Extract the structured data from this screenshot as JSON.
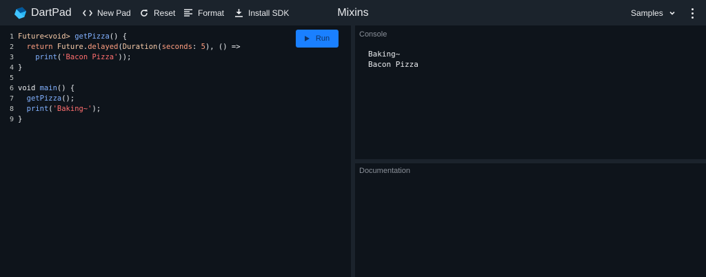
{
  "app": {
    "name": "DartPad",
    "title": "Mixins"
  },
  "toolbar": {
    "new_pad": "New Pad",
    "reset": "Reset",
    "format": "Format",
    "install_sdk": "Install SDK",
    "samples": "Samples"
  },
  "editor": {
    "run_label": "Run",
    "lines": [
      {
        "n": "1",
        "tokens": [
          [
            "Future<void> ",
            "t-type"
          ],
          [
            "getPizza",
            "t-fn"
          ],
          [
            "() {",
            ""
          ]
        ]
      },
      {
        "n": "2",
        "tokens": [
          [
            "  ",
            ""
          ],
          [
            "return ",
            "t-ret"
          ],
          [
            "Future",
            "t-type"
          ],
          [
            ".",
            ""
          ],
          [
            "delayed",
            "t-param"
          ],
          [
            "(",
            ""
          ],
          [
            "Duration",
            "t-type"
          ],
          [
            "(",
            ""
          ],
          [
            "seconds",
            "t-param"
          ],
          [
            ": ",
            ""
          ],
          [
            "5",
            "t-num"
          ],
          [
            "), () =>",
            ""
          ]
        ]
      },
      {
        "n": "3",
        "tokens": [
          [
            "    ",
            ""
          ],
          [
            "print",
            "t-fn"
          ],
          [
            "(",
            ""
          ],
          [
            "'Bacon Pizza'",
            "t-str"
          ],
          [
            "));",
            ""
          ]
        ]
      },
      {
        "n": "4",
        "tokens": [
          [
            "}",
            ""
          ]
        ]
      },
      {
        "n": "5",
        "tokens": [
          [
            "",
            ""
          ]
        ]
      },
      {
        "n": "6",
        "tokens": [
          [
            "void ",
            "t-kw"
          ],
          [
            "main",
            "t-fn"
          ],
          [
            "() {",
            ""
          ]
        ]
      },
      {
        "n": "7",
        "tokens": [
          [
            "  ",
            ""
          ],
          [
            "getPizza",
            "t-fn"
          ],
          [
            "();",
            ""
          ]
        ]
      },
      {
        "n": "8",
        "tokens": [
          [
            "  ",
            ""
          ],
          [
            "print",
            "t-fn"
          ],
          [
            "(",
            ""
          ],
          [
            "'Baking~'",
            "t-str"
          ],
          [
            ");",
            ""
          ]
        ]
      },
      {
        "n": "9",
        "tokens": [
          [
            "}",
            ""
          ]
        ]
      }
    ]
  },
  "console": {
    "title": "Console",
    "output": [
      "Baking~",
      "Bacon Pizza"
    ]
  },
  "documentation": {
    "title": "Documentation"
  },
  "colors": {
    "background": "#0e141b",
    "header": "#1b232c",
    "run_button": "#1a80ff",
    "function": "#82b1ff",
    "string": "#ff6e6e"
  },
  "icons": {
    "logo": "dart-logo-icon",
    "new_pad": "code-brackets-icon",
    "reset": "refresh-icon",
    "format": "format-lines-icon",
    "install_sdk": "download-icon",
    "samples": "chevron-down-icon",
    "more": "more-vert-icon",
    "run": "play-icon"
  }
}
